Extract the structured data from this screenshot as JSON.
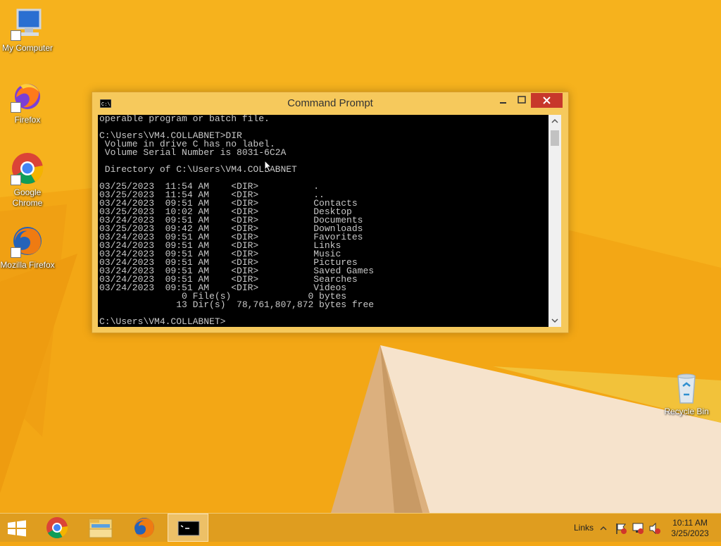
{
  "desktop": {
    "icons": [
      {
        "label": "My Computer"
      },
      {
        "label": "Firefox"
      },
      {
        "label": "Google Chrome"
      },
      {
        "label": "Mozilla Firefox"
      },
      {
        "label": "Recycle Bin"
      }
    ]
  },
  "window": {
    "title": "Command Prompt",
    "console_text": "operable program or batch file.\n\nC:\\Users\\VM4.COLLABNET>DIR\n Volume in drive C has no label.\n Volume Serial Number is 8031-6C2A\n\n Directory of C:\\Users\\VM4.COLLABNET\n\n03/25/2023  11:54 AM    <DIR>          .\n03/25/2023  11:54 AM    <DIR>          ..\n03/24/2023  09:51 AM    <DIR>          Contacts\n03/25/2023  10:02 AM    <DIR>          Desktop\n03/24/2023  09:51 AM    <DIR>          Documents\n03/25/2023  09:42 AM    <DIR>          Downloads\n03/24/2023  09:51 AM    <DIR>          Favorites\n03/24/2023  09:51 AM    <DIR>          Links\n03/24/2023  09:51 AM    <DIR>          Music\n03/24/2023  09:51 AM    <DIR>          Pictures\n03/24/2023  09:51 AM    <DIR>          Saved Games\n03/24/2023  09:51 AM    <DIR>          Searches\n03/24/2023  09:51 AM    <DIR>          Videos\n               0 File(s)              0 bytes\n              13 Dir(s)  78,761,807,872 bytes free\n\nC:\\Users\\VM4.COLLABNET>"
  },
  "taskbar": {
    "items": [
      "start-button",
      "chrome",
      "file-explorer",
      "firefox",
      "command-prompt"
    ],
    "tray_links": "Links",
    "clock_time": "10:11 AM",
    "clock_date": "3/25/2023"
  },
  "colors": {
    "wallpaper": "#f3a715",
    "window_frame": "#f6c95c",
    "close_button": "#c7382b"
  }
}
